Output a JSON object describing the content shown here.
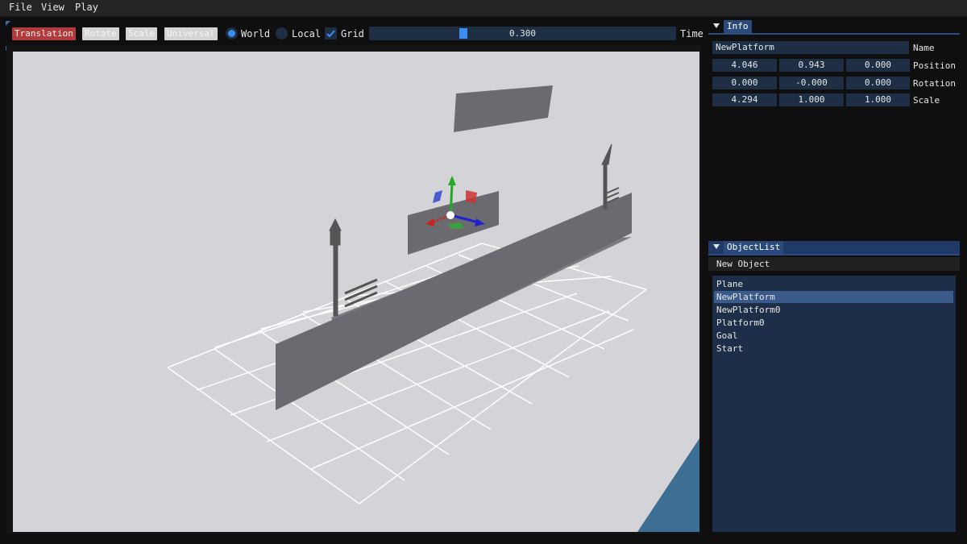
{
  "menu": {
    "items": [
      "File",
      "View",
      "Play"
    ]
  },
  "toolbar": {
    "modes": [
      {
        "label": "Translation",
        "active": true
      },
      {
        "label": "Rotate",
        "active": false
      },
      {
        "label": "Scale",
        "active": false
      },
      {
        "label": "Universal",
        "active": false
      }
    ],
    "space_world": "World",
    "space_local": "Local",
    "space_selected": "World",
    "grid_label": "Grid",
    "grid_checked": true,
    "time_value_text": "0.300",
    "time_fraction": 0.3,
    "time_label": "Time"
  },
  "info_panel": {
    "tab_label": "Info",
    "name_value": "NewPlatform",
    "name_label": "Name",
    "position": {
      "label": "Position",
      "x": "4.046",
      "y": "0.943",
      "z": "0.000"
    },
    "rotation": {
      "label": "Rotation",
      "x": "0.000",
      "y": "-0.000",
      "z": "0.000"
    },
    "scale": {
      "label": "Scale",
      "x": "4.294",
      "y": "1.000",
      "z": "1.000"
    }
  },
  "object_panel": {
    "tab_label": "ObjectList",
    "new_object_label": "New Object",
    "items": [
      "Plane",
      "NewPlatform",
      "NewPlatform0",
      "Platform0",
      "Goal",
      "Start"
    ],
    "selected_index": 1
  },
  "colors": {
    "accent": "#3d8df0",
    "active_mode": "#b33a3a",
    "panel_field": "#1e2e44",
    "tab": "#294a7a",
    "viewport_bg": "#d3d3d8",
    "platform": "#6a6a70",
    "gizmo_x": "#cc2222",
    "gizmo_y": "#22aa22",
    "gizmo_z": "#2222cc"
  }
}
